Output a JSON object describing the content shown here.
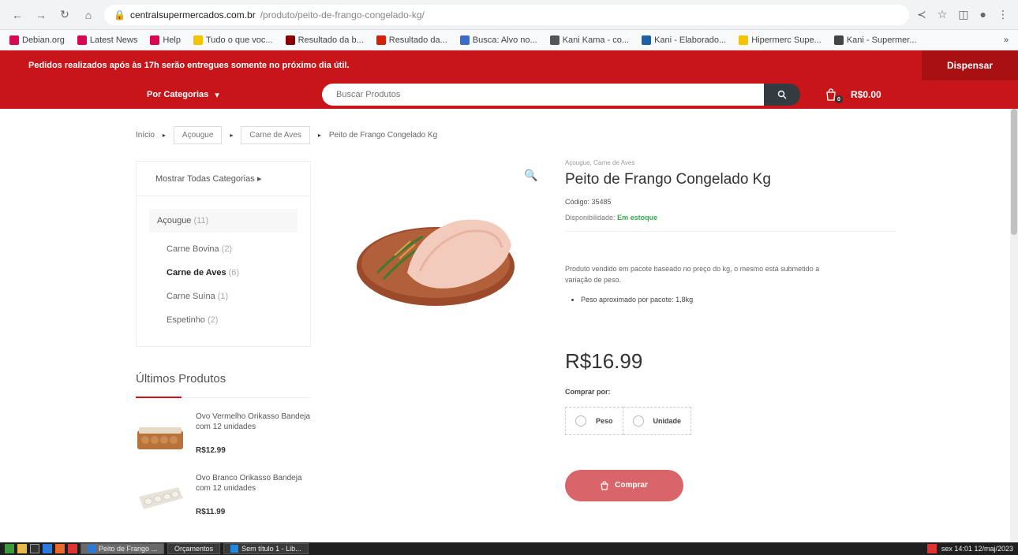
{
  "browser": {
    "url_host": "centralsupermercados.com.br",
    "url_path": "/produto/peito-de-frango-congelado-kg/"
  },
  "bookmarks": [
    {
      "label": "Debian.org",
      "color": "#d70751"
    },
    {
      "label": "Latest News",
      "color": "#d70751"
    },
    {
      "label": "Help",
      "color": "#d70751"
    },
    {
      "label": "Tudo o que voc...",
      "color": "#f3c300"
    },
    {
      "label": "Resultado da b...",
      "color": "#8b0000"
    },
    {
      "label": "Resultado da...",
      "color": "#d81e05"
    },
    {
      "label": "Busca: Alvo no...",
      "color": "#3b6dc6"
    },
    {
      "label": "Kani Kama - co...",
      "color": "#555555"
    },
    {
      "label": "Kani - Elaborado...",
      "color": "#1f5fa6"
    },
    {
      "label": "Hipermerc Supe...",
      "color": "#f5c400"
    },
    {
      "label": "Kani - Supermer...",
      "color": "#444444"
    }
  ],
  "header": {
    "notice": "Pedidos realizados após às 17h serão entregues somente no próximo dia útil.",
    "dismiss": "Dispensar",
    "categories": "Por Categorias",
    "search_placeholder": "Buscar Produtos",
    "cart_total": "R$0.00",
    "cart_count": "0"
  },
  "breadcrumb": {
    "home": "Início",
    "level1": "Açougue",
    "level2": "Carne de Aves",
    "current": "Peito de Frango Congelado Kg"
  },
  "sidebar": {
    "all": "Mostrar Todas Categorias",
    "parent": "Açougue",
    "parent_count": "(11)",
    "items": [
      {
        "label": "Carne Bovina",
        "count": "(2)"
      },
      {
        "label": "Carne de Aves",
        "count": "(6)"
      },
      {
        "label": "Carne Suína",
        "count": "(1)"
      },
      {
        "label": "Espetinho",
        "count": "(2)"
      }
    ]
  },
  "latest": {
    "title": "Últimos Produtos",
    "items": [
      {
        "name": "Ovo Vermelho Orikasso Bandeja com 12 unidades",
        "price": "R$12.99"
      },
      {
        "name": "Ovo Branco Orikasso Bandeja com 12 unidades",
        "price": "R$11.99"
      }
    ]
  },
  "product": {
    "category": "Açougue, Carne de Aves",
    "title": "Peito de Frango Congelado Kg",
    "code": "Código: 35485",
    "availability_label": "Disponibilidade:",
    "availability_value": "Em estoque",
    "description": "Produto vendido em pacote baseado no preço do kg, o mesmo está submetido a variação de peso.",
    "bullets": [
      "Peso aproximado por pacote: 1,8kg"
    ],
    "price": "R$16.99",
    "buy_by": "Comprar por:",
    "option_weight": "Peso",
    "option_unit": "Unidade",
    "buy_button": "Comprar"
  },
  "taskbar": {
    "tasks": [
      {
        "label": "Peito de Frango ..."
      },
      {
        "label": "Orçamentos"
      },
      {
        "label": "Sem título 1 - Lib..."
      }
    ],
    "clock": "sex 14:01 12/maj/2023"
  }
}
